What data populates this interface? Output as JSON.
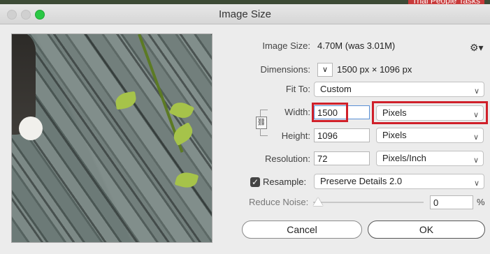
{
  "background": {
    "nav_text": "Trial   People   Tasks"
  },
  "window": {
    "title": "Image Size"
  },
  "info": {
    "image_size_label": "Image Size:",
    "image_size_value": "4.70M (was 3.01M)",
    "dimensions_label": "Dimensions:",
    "dimensions_value": "1500 px  ×  1096 px"
  },
  "form": {
    "fit_to_label": "Fit To:",
    "fit_to_value": "Custom",
    "width_label": "Width:",
    "width_value": "1500",
    "width_unit": "Pixels",
    "height_label": "Height:",
    "height_value": "1096",
    "height_unit": "Pixels",
    "resolution_label": "Resolution:",
    "resolution_value": "72",
    "resolution_unit": "Pixels/Inch",
    "resample_label": "Resample:",
    "resample_value": "Preserve Details 2.0",
    "resample_checked": true,
    "reduce_noise_label": "Reduce Noise:",
    "reduce_noise_value": "0",
    "percent_sign": "%"
  },
  "buttons": {
    "cancel": "Cancel",
    "ok": "OK"
  },
  "icons": {
    "gear": "gear-icon",
    "link": "chain-link-icon",
    "chevron": "chevron-down-icon"
  },
  "colors": {
    "highlight": "#d0202a",
    "window_bg": "#ececec"
  }
}
